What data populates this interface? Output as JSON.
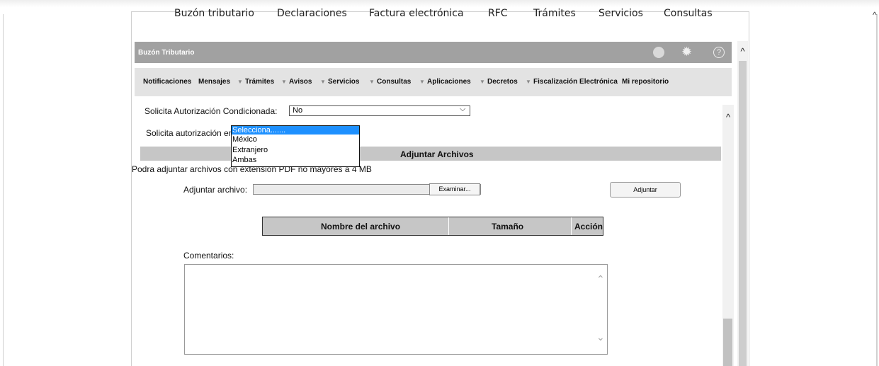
{
  "nav": {
    "items": [
      "Buzón tributario",
      "Declaraciones",
      "Factura electrónica",
      "RFC",
      "Trámites",
      "Servicios",
      "Consultas"
    ]
  },
  "panel": {
    "title": "Buzón Tributario",
    "help_glyph": "?"
  },
  "menu": {
    "items": [
      "Notificaciones",
      "Mensajes",
      "Trámites",
      "Avisos",
      "Servicios",
      "Consultas",
      "Aplicaciones",
      "Decretos",
      "Fiscalización Electrónica",
      "Mi repositorio"
    ],
    "caret": "▼"
  },
  "form": {
    "conditional_label": "Solicita Autorización Condicionada:",
    "conditional_value": "No",
    "location_label": "Solicita autorización en:",
    "location_options": [
      "Selecciona.......",
      "México",
      "Extranjero",
      "Ambas"
    ]
  },
  "attachments": {
    "section_title": "Adjuntar Archivos",
    "note": "Podra adjuntar archivos con extension PDF no mayores a 4 MB",
    "file_label": "Adjuntar archivo:",
    "browse_label": "Examinar...",
    "attach_label": "Adjuntar",
    "table_headers": [
      "Nombre del archivo",
      "Tamaño",
      "Acción"
    ]
  },
  "comments": {
    "label": "Comentarios:"
  },
  "colors": {
    "titlebar": "#a1a1a1",
    "menubar": "#e3e3e3",
    "band": "#c6c6c6",
    "selected_option": "#1e90ff"
  }
}
